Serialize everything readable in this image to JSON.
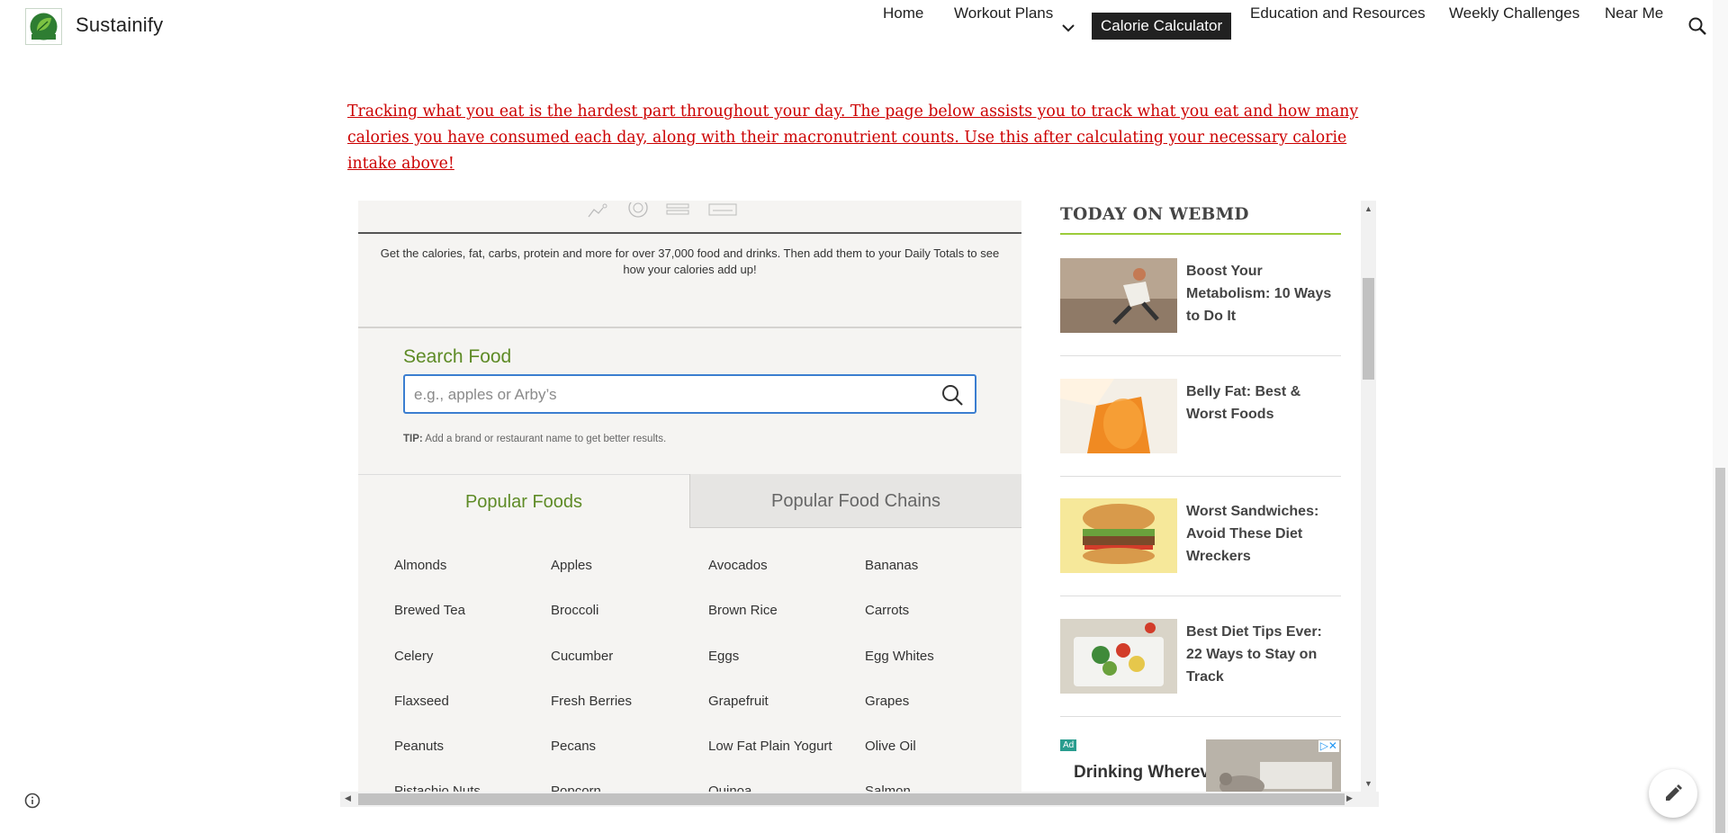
{
  "header": {
    "site_title": "Sustainify",
    "nav": [
      {
        "label": "Home"
      },
      {
        "label": "Workout Plans"
      },
      {
        "label": "Calorie Calculator",
        "active": true
      },
      {
        "label": "Education and Resources"
      },
      {
        "label": "Weekly Challenges"
      },
      {
        "label": "Near Me"
      }
    ]
  },
  "notice": "Tracking what you eat is the hardest part throughout your day. The page below assists you to track what you eat and how many calories you have consumed each day, along with their macronutrient counts. Use this after calculating your necessary calorie intake above!",
  "calculator": {
    "intro": "Get the calories, fat, carbs, protein and more for over 37,000 food and drinks. Then add them to your Daily Totals to see how your calories add up!",
    "search_label": "Search Food",
    "search_placeholder": "e.g., apples or Arby’s",
    "tip_label": "TIP:",
    "tip_text": "Add a brand or restaurant name to get better results.",
    "tabs": [
      "Popular Foods",
      "Popular Food Chains"
    ],
    "foods": [
      "Almonds",
      "Apples",
      "Avocados",
      "Bananas",
      "Brewed Tea",
      "Broccoli",
      "Brown Rice",
      "Carrots",
      "Celery",
      "Cucumber",
      "Eggs",
      "Egg Whites",
      "Flaxseed",
      "Fresh Berries",
      "Grapefruit",
      "Grapes",
      "Peanuts",
      "Pecans",
      "Low Fat Plain Yogurt",
      "Olive Oil",
      "Pistachio Nuts",
      "Popcorn",
      "Quinoa",
      "Salmon"
    ]
  },
  "sidebar": {
    "title": "TODAY ON WEBMD",
    "articles": [
      {
        "title": "Boost Your Metabolism: 10 Ways to Do It"
      },
      {
        "title": "Belly Fat: Best & Worst Foods"
      },
      {
        "title": "Worst Sandwiches: Avoid These Diet Wreckers"
      },
      {
        "title": "Best Diet Tips Ever: 22 Ways to Stay on Track"
      }
    ],
    "ad": {
      "badge": "Ad",
      "text": "Drinking Wherever"
    }
  },
  "colors": {
    "accent_green": "#5e8b26",
    "notice_red": "#cc0000",
    "nav_active_bg": "#212121",
    "sidebar_rule": "#9ccc3a",
    "search_border": "#3b7ed0"
  }
}
